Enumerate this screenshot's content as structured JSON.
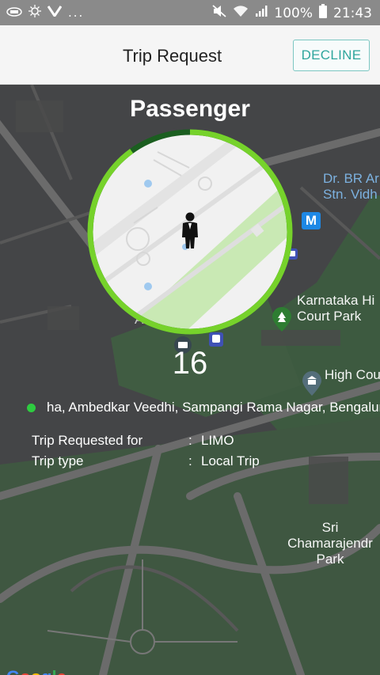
{
  "status_bar": {
    "left_icons": [
      "carrier-icon",
      "sync-icon",
      "v-icon"
    ],
    "more": "...",
    "battery": "100%",
    "time": "21:43"
  },
  "app_bar": {
    "title": "Trip Request",
    "decline_label": "DECLINE"
  },
  "map": {
    "labels": [
      "Dr. BR Ar\nStn. Vidh",
      "Karnataka Hi\nCourt Park",
      "High Cou",
      "Sri\nChamarajendr\nPark",
      "Axis Bank"
    ],
    "metro_badge": "M",
    "attribution": "Google"
  },
  "request": {
    "passenger_label": "Passenger",
    "countdown": "16",
    "timer_progress": 0.9,
    "address": "ha, Ambedkar Veedhi, Sampangi Rama Nagar, Bengaluru",
    "trip_requested_for_label": "Trip Requested for",
    "trip_requested_for_value": "LIMO",
    "trip_type_label": "Trip type",
    "trip_type_value": "Local Trip",
    "separator": ":"
  }
}
